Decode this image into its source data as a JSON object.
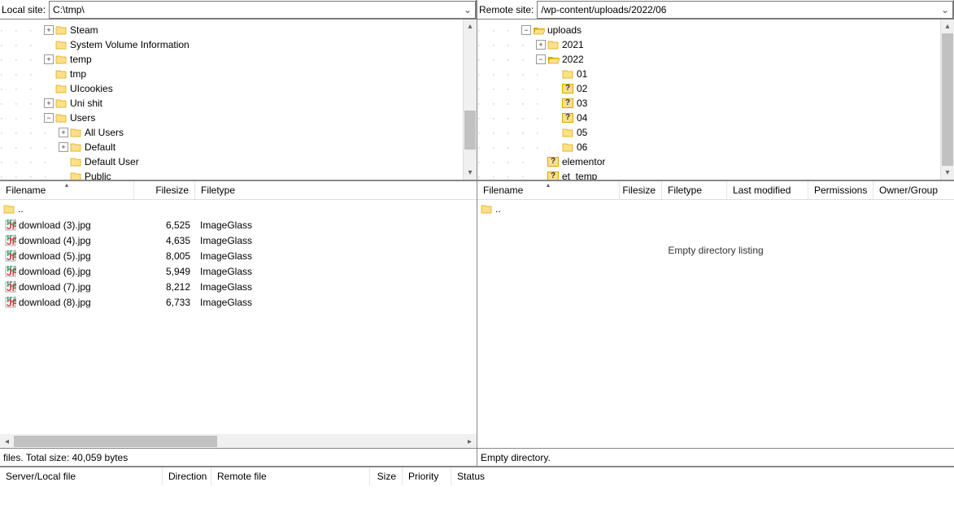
{
  "local": {
    "label": "Local site:",
    "path": "C:\\tmp\\",
    "tree": [
      {
        "indent": 3,
        "exp": "+",
        "name": "Steam"
      },
      {
        "indent": 3,
        "exp": "",
        "name": "System Volume Information"
      },
      {
        "indent": 3,
        "exp": "+",
        "name": "temp"
      },
      {
        "indent": 3,
        "exp": "",
        "name": "tmp"
      },
      {
        "indent": 3,
        "exp": "",
        "name": "UIcookies"
      },
      {
        "indent": 3,
        "exp": "+",
        "name": "Uni shit"
      },
      {
        "indent": 3,
        "exp": "-",
        "name": "Users"
      },
      {
        "indent": 4,
        "exp": "+",
        "name": "All Users"
      },
      {
        "indent": 4,
        "exp": "+",
        "name": "Default"
      },
      {
        "indent": 4,
        "exp": "",
        "name": "Default User"
      },
      {
        "indent": 4,
        "exp": "",
        "name": "Public"
      }
    ],
    "columns": [
      "Filename",
      "Filesize",
      "Filetype"
    ],
    "parent": "..",
    "files": [
      {
        "name": "download (3).jpg",
        "size": "6,525",
        "type": "ImageGlass"
      },
      {
        "name": "download (4).jpg",
        "size": "4,635",
        "type": "ImageGlass"
      },
      {
        "name": "download (5).jpg",
        "size": "8,005",
        "type": "ImageGlass"
      },
      {
        "name": "download (6).jpg",
        "size": "5,949",
        "type": "ImageGlass"
      },
      {
        "name": "download (7).jpg",
        "size": "8,212",
        "type": "ImageGlass"
      },
      {
        "name": "download (8).jpg",
        "size": "6,733",
        "type": "ImageGlass"
      }
    ],
    "status": "files. Total size: 40,059 bytes"
  },
  "remote": {
    "label": "Remote site:",
    "path": "/wp-content/uploads/2022/06",
    "tree": [
      {
        "indent": 3,
        "exp": "-",
        "icon": "open",
        "name": "uploads"
      },
      {
        "indent": 4,
        "exp": "+",
        "icon": "folder",
        "name": "2021"
      },
      {
        "indent": 4,
        "exp": "-",
        "icon": "open",
        "name": "2022"
      },
      {
        "indent": 5,
        "exp": "",
        "icon": "folder",
        "name": "01"
      },
      {
        "indent": 5,
        "exp": "",
        "icon": "q",
        "name": "02"
      },
      {
        "indent": 5,
        "exp": "",
        "icon": "q",
        "name": "03"
      },
      {
        "indent": 5,
        "exp": "",
        "icon": "q",
        "name": "04"
      },
      {
        "indent": 5,
        "exp": "",
        "icon": "folder",
        "name": "05"
      },
      {
        "indent": 5,
        "exp": "",
        "icon": "folder",
        "name": "06"
      },
      {
        "indent": 4,
        "exp": "",
        "icon": "q",
        "name": "elementor"
      },
      {
        "indent": 4,
        "exp": "",
        "icon": "q",
        "name": "et_temp"
      }
    ],
    "columns": [
      "Filename",
      "Filesize",
      "Filetype",
      "Last modified",
      "Permissions",
      "Owner/Group"
    ],
    "parent": "..",
    "empty": "Empty directory listing",
    "status": "Empty directory."
  },
  "queue_columns": [
    "Server/Local file",
    "Direction",
    "Remote file",
    "Size",
    "Priority",
    "Status"
  ]
}
